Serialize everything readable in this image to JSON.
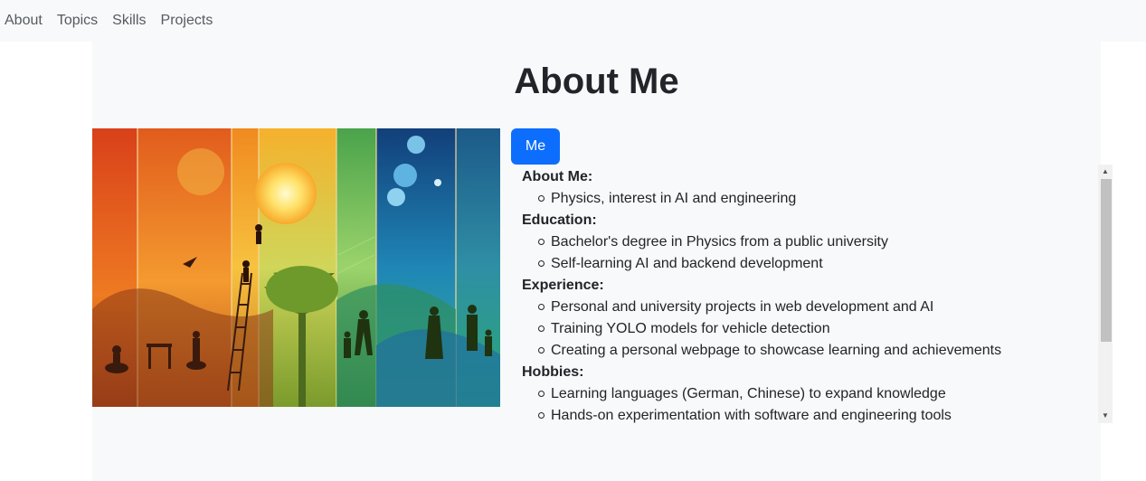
{
  "nav": {
    "items": [
      {
        "label": "About"
      },
      {
        "label": "Topics"
      },
      {
        "label": "Skills"
      },
      {
        "label": "Projects"
      }
    ]
  },
  "page": {
    "title": "About Me"
  },
  "tabs": {
    "active_label": "Me"
  },
  "about": {
    "sections": [
      {
        "heading": "About Me:",
        "items": [
          "Physics, interest in AI and engineering"
        ]
      },
      {
        "heading": "Education:",
        "items": [
          "Bachelor's degree in Physics from a public university",
          "Self-learning AI and backend development"
        ]
      },
      {
        "heading": "Experience:",
        "items": [
          "Personal and university projects in web development and AI",
          "Training YOLO models for vehicle detection",
          "Creating a personal webpage to showcase learning and achievements"
        ]
      },
      {
        "heading": "Hobbies:",
        "items": [
          "Learning languages (German, Chinese) to expand knowledge",
          "Hands-on experimentation with software and engineering tools"
        ]
      }
    ]
  },
  "image": {
    "subject": "illustrated panels of silhouettes progressing from sunrise to ocean"
  },
  "colors": {
    "accent": "#0d6efd",
    "navbar_bg": "#f8f9fa",
    "text": "#212529"
  }
}
